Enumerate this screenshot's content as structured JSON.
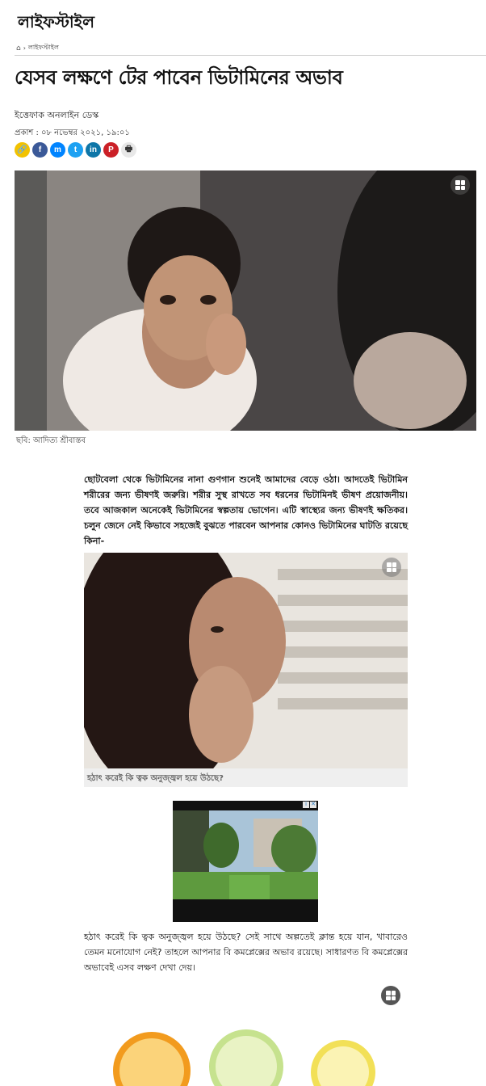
{
  "header": {
    "section_title": "লাইফস্টাইল",
    "breadcrumb_home_icon": "home-icon",
    "breadcrumb_separator": "›",
    "breadcrumb_current": "লাইফস্টাইল"
  },
  "article": {
    "headline": "যেসব লক্ষণে টের পাবেন ভিটামিনের অভাব",
    "author": "ইত্তেফাক অনলাইন ডেস্ক",
    "published": "প্রকাশ : ০৮ নভেম্বর ২০২১, ১৯:০১",
    "share_buttons": [
      {
        "name": "copy-link-icon",
        "glyph": "🔗",
        "color": "#f2c200"
      },
      {
        "name": "facebook-icon",
        "glyph": "f",
        "color": "#3b5998"
      },
      {
        "name": "messenger-icon",
        "glyph": "m",
        "color": "#0084ff"
      },
      {
        "name": "twitter-icon",
        "glyph": "t",
        "color": "#1da1f2"
      },
      {
        "name": "linkedin-icon",
        "glyph": "in",
        "color": "#0e76a8"
      },
      {
        "name": "pinterest-icon",
        "glyph": "P",
        "color": "#cb2027"
      },
      {
        "name": "print-icon",
        "glyph": "🖶",
        "color": "#e8e8e8"
      }
    ],
    "hero_caption": "ছবি: আদিত্য শ্রীবাস্তব",
    "lead_paragraph": "ছোটবেলা থেকে ভিটামিনের নানা গুণগান শুনেই আমাদের বেড়ে ওঠা। আদতেই ভিটামিন শরীরের জন্য ভীষণই জরুরি। শরীর সুস্থ রাখতে সব ধরনের ভিটামিনই ভীষণ প্রয়োজনীয়। তবে আজকাল অনেকেই ভিটামিনের স্বল্পতায় ভোগেন। এটি স্বাস্থ্যের জন্য ভীষণই ক্ষতিকর। চলুন জেনে নেই কিভাবে সহজেই বুঝতে পারবেন আপনার কোনও ভিটামিনের ঘাটতি রয়েছে কিনা-",
    "inline_image_caption": "হঠাৎ করেই কি ত্বক অনুজ্জ্বল হয়ে উঠছে?",
    "second_paragraph": "হঠাৎ করেই কি ত্বক অনুজ্জ্বল হয়ে উঠছে? সেই সাথে অল্পতেই ক্লান্ত হয়ে যান, খাবারেও তেমন মনোযোগ নেই? তাহলে আপনার বি কমপ্লেক্সের অভাব রয়েছে। সাধারণত বি কমপ্লেক্সের অভাবেই এসব লক্ষণ দেখা দেয়।"
  },
  "ad": {
    "badge_info": "i",
    "badge_close": "✕"
  }
}
